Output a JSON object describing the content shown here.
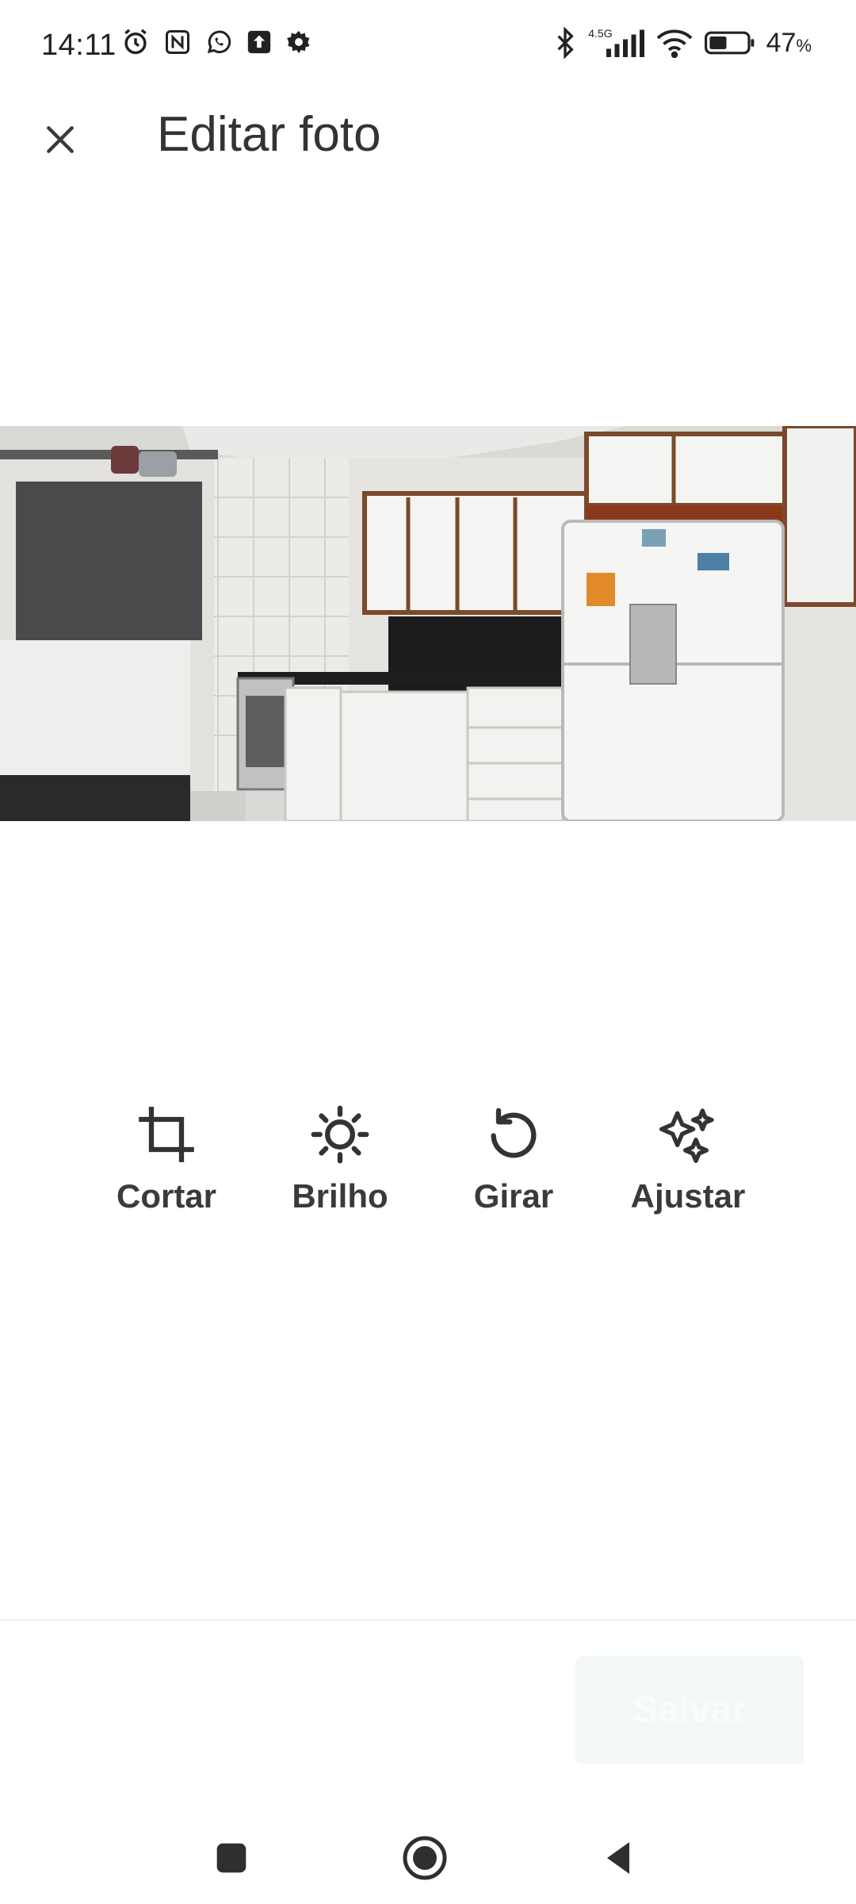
{
  "status_bar": {
    "time": "14:11",
    "network_label": "4.5G",
    "battery": "47",
    "battery_unit": "%",
    "left_icons": [
      "alarm-icon",
      "nfc-icon",
      "whatsapp-icon",
      "upload-icon",
      "settings-icon"
    ],
    "right_icons": [
      "bluetooth-icon",
      "signal-icon",
      "wifi-icon",
      "battery-icon"
    ]
  },
  "app_bar": {
    "close_icon": "close-icon",
    "title": "Editar foto"
  },
  "photo": {
    "icon": "kitchen-photo",
    "battery_level": 0.47
  },
  "tools": [
    {
      "label": "Cortar",
      "icon": "crop-icon"
    },
    {
      "label": "Brilho",
      "icon": "brightness-icon"
    },
    {
      "label": "Girar",
      "icon": "rotate-icon"
    },
    {
      "label": "Ajustar",
      "icon": "sparkle-icon"
    }
  ],
  "footer": {
    "save_label": "Salvar"
  },
  "nav_bar": {
    "icons": [
      "recents-icon",
      "home-icon",
      "back-icon"
    ]
  },
  "colors": {
    "background": "#ffffff",
    "text": "#333333",
    "save_button_bg": "#f3f7f7",
    "save_button_text": "#fafcfc",
    "icon": "#2f2f2f"
  }
}
